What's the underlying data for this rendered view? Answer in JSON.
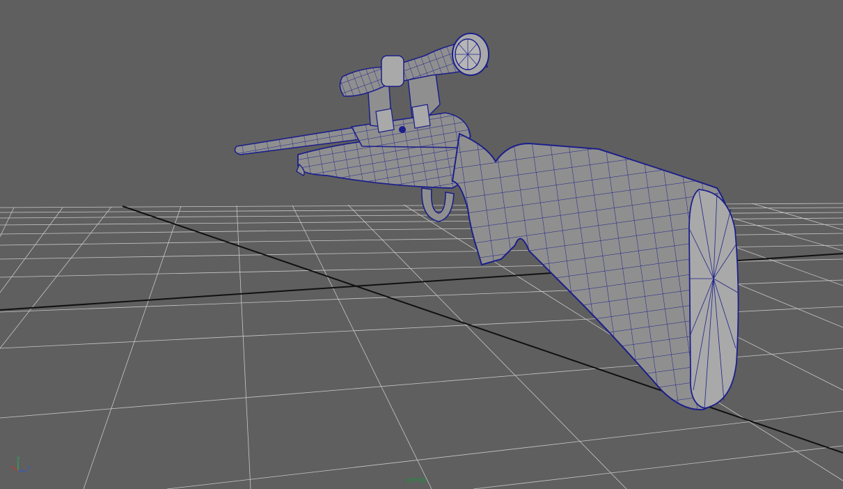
{
  "viewport": {
    "camera": "persp",
    "axes": {
      "x": "x",
      "y": "y",
      "z": "z"
    },
    "colors": {
      "background": "#5f5f5f",
      "grid": "#c8c8c8",
      "axis_lines": "#101010",
      "wireframe": "#1c1f8a",
      "mesh_fill": "#8f8f8f",
      "camera_label": "#1f8f3a",
      "axis_x": "#c0392b",
      "axis_y": "#27ae60",
      "axis_z": "#2e5bd6"
    }
  }
}
